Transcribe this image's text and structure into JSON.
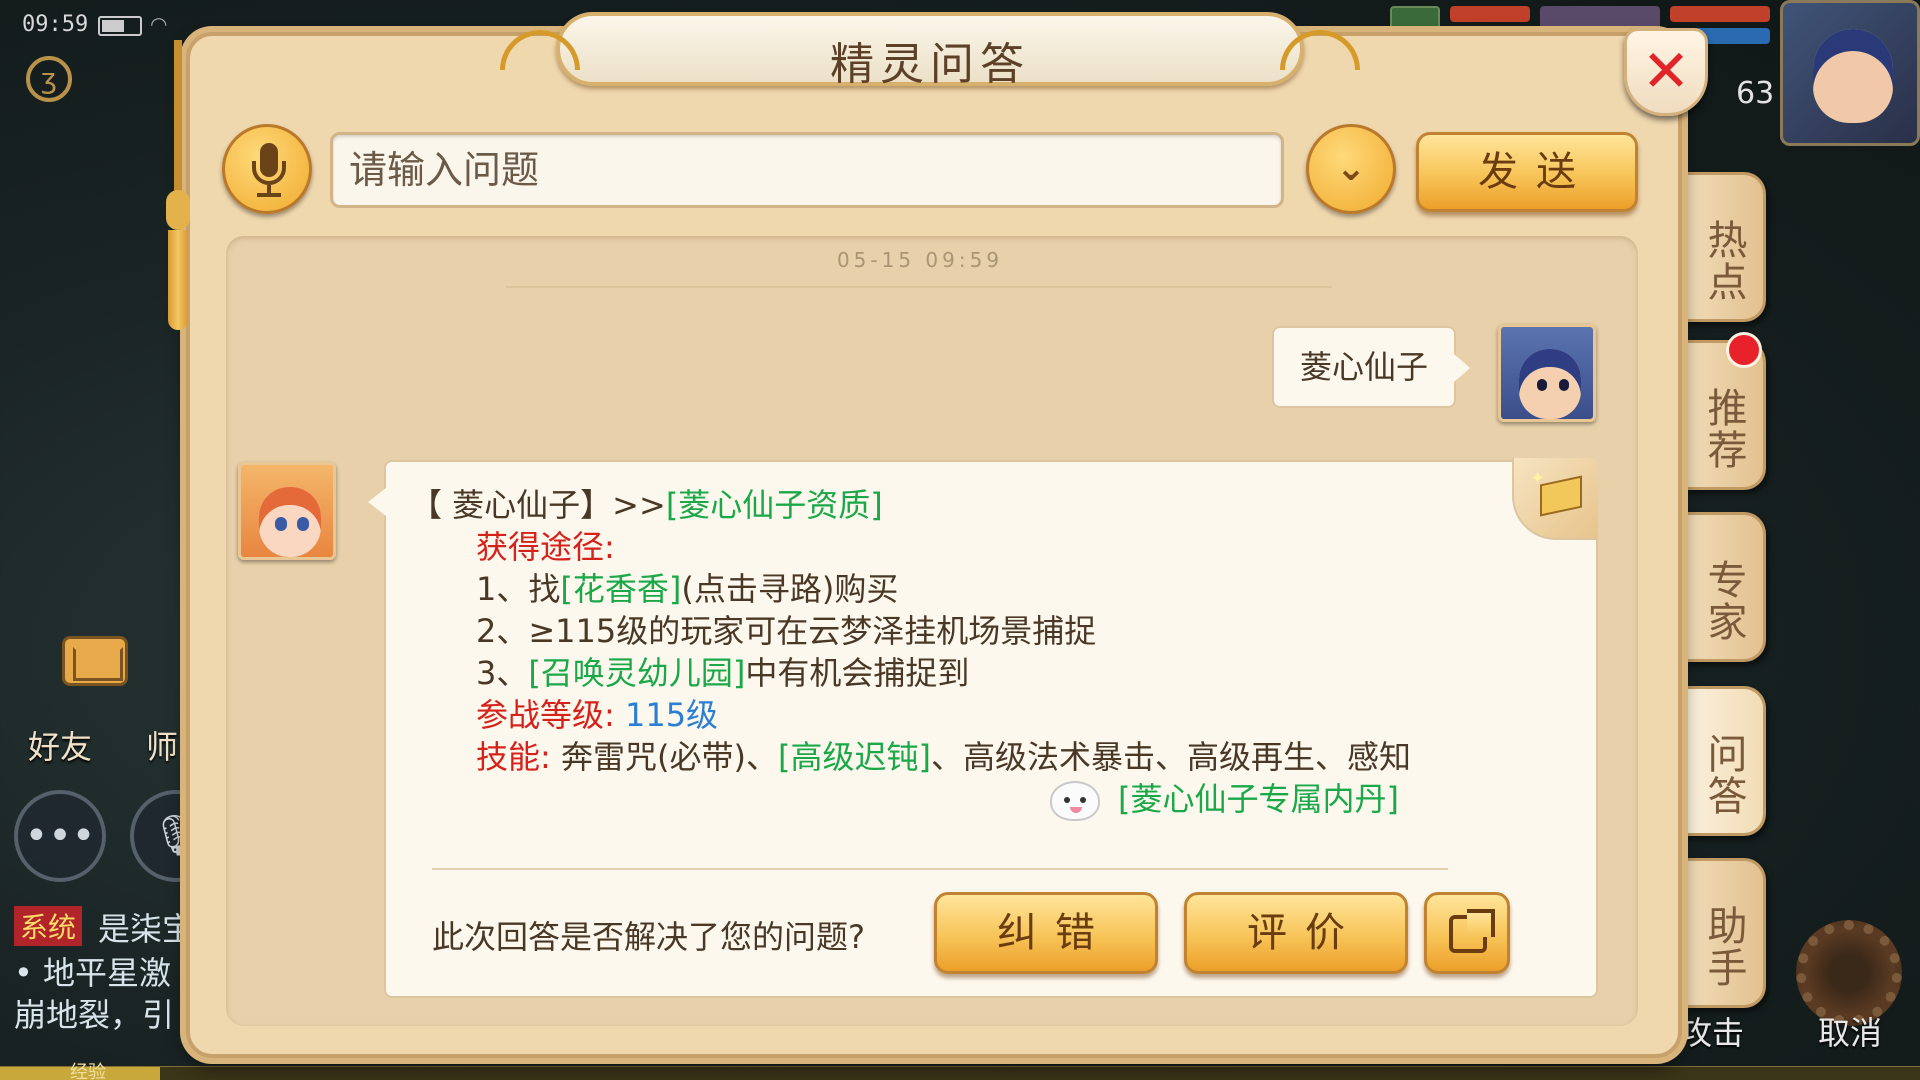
{
  "status_bar": {
    "time": "09:59"
  },
  "hud": {
    "level": "63",
    "friends_label": "好友",
    "master_label": "师",
    "system_tag": "系统",
    "chat_line1": "是柒宝",
    "chat_line2": "• 地平星激",
    "chat_line3": "崩地裂，引",
    "exp_label": "经验",
    "attack_label": "攻击",
    "cancel_label": "取消"
  },
  "dialog": {
    "title": "精灵问答",
    "close_label": "✕",
    "input_placeholder": "请输入问题",
    "send_label": "发送",
    "timestamp": "05-15 09:59"
  },
  "side_tabs": [
    {
      "label": "热点"
    },
    {
      "label": "推荐"
    },
    {
      "label": "专家"
    },
    {
      "label": "问答"
    },
    {
      "label": "助手"
    }
  ],
  "conversation": {
    "user_message": "菱心仙子",
    "answer": {
      "name_part": "【 菱心仙子】>>",
      "name_link": "[菱心仙子资质]",
      "source_label": "获得途径:",
      "route1_prefix": "1、找",
      "route1_link": "[花香香]",
      "route1_suffix": "(点击寻路)购买",
      "route2": "2、≥115级的玩家可在云梦泽挂机场景捕捉",
      "route3_prefix": "3、",
      "route3_link": "[召唤灵幼儿园]",
      "route3_suffix": "中有机会捕捉到",
      "level_label": "参战等级:",
      "level_value": "115级",
      "skill_label": "技能:",
      "skill_text1": "奔雷咒(必带)、",
      "skill_link": "[高级迟钝]",
      "skill_text2": "、高级法术暴击、高级再生、感知",
      "core_link": "[菱心仙子专属内丹]"
    },
    "feedback_question": "此次回答是否解决了您的问题?",
    "fix_label": "纠错",
    "rate_label": "评价"
  },
  "colors": {
    "accent_gold": "#f7c458",
    "link_green": "#1aa848",
    "label_red": "#d5221a",
    "value_blue": "#2a7fd4"
  }
}
